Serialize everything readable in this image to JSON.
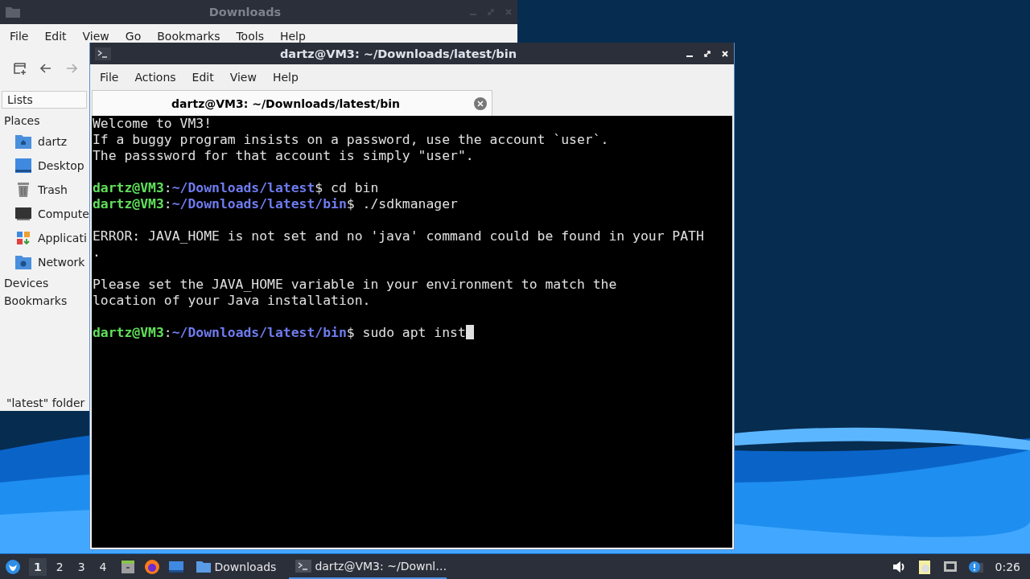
{
  "file_manager": {
    "title": "Downloads",
    "active": false,
    "menu": [
      "File",
      "Edit",
      "View",
      "Go",
      "Bookmarks",
      "Tools",
      "Help"
    ],
    "sidebar_tab": "Lists",
    "sections": [
      {
        "label": "Places",
        "items": [
          "dartz",
          "Desktop",
          "Trash",
          "Compute",
          "Applicati",
          "Network"
        ]
      },
      {
        "label": "Devices"
      },
      {
        "label": "Bookmarks"
      }
    ],
    "status": "\"latest\" folder"
  },
  "terminal": {
    "title": "dartz@VM3: ~/Downloads/latest/bin",
    "active": true,
    "menu": [
      "File",
      "Actions",
      "Edit",
      "View",
      "Help"
    ],
    "tabs": [
      {
        "label": "dartz@VM3: ~/Downloads/latest/bin",
        "selected": true
      }
    ],
    "lines": [
      {
        "kind": "text",
        "text": "Welcome to VM3!"
      },
      {
        "kind": "text",
        "text": "If a buggy program insists on a password, use the account `user`."
      },
      {
        "kind": "text",
        "text": "The passsword for that account is simply \"user\"."
      },
      {
        "kind": "blank"
      },
      {
        "kind": "prompt",
        "user": "dartz@VM3",
        "separator": ":",
        "path": "~/Downloads/latest",
        "command": "$ cd bin",
        "cursor": false
      },
      {
        "kind": "prompt",
        "user": "dartz@VM3",
        "separator": ":",
        "path": "~/Downloads/latest/bin",
        "command": "$ ./sdkmanager",
        "cursor": false
      },
      {
        "kind": "blank"
      },
      {
        "kind": "text",
        "text": "ERROR: JAVA_HOME is not set and no 'java' command could be found in your PATH"
      },
      {
        "kind": "text",
        "text": "."
      },
      {
        "kind": "blank"
      },
      {
        "kind": "text",
        "text": "Please set the JAVA_HOME variable in your environment to match the"
      },
      {
        "kind": "text",
        "text": "location of your Java installation."
      },
      {
        "kind": "blank"
      },
      {
        "kind": "prompt",
        "user": "dartz@VM3",
        "separator": ":",
        "path": "~/Downloads/latest/bin",
        "command": "$ sudo apt inst",
        "cursor": true
      }
    ]
  },
  "taskbar": {
    "workspaces": [
      {
        "label": "1",
        "selected": true
      },
      {
        "label": "2",
        "selected": false
      },
      {
        "label": "3",
        "selected": false
      },
      {
        "label": "4",
        "selected": false
      }
    ],
    "tasks": [
      {
        "label": "Downloads",
        "selected": false
      },
      {
        "label": "dartz@VM3: ~/Downl…",
        "selected": true
      }
    ],
    "clock": "0:26"
  }
}
